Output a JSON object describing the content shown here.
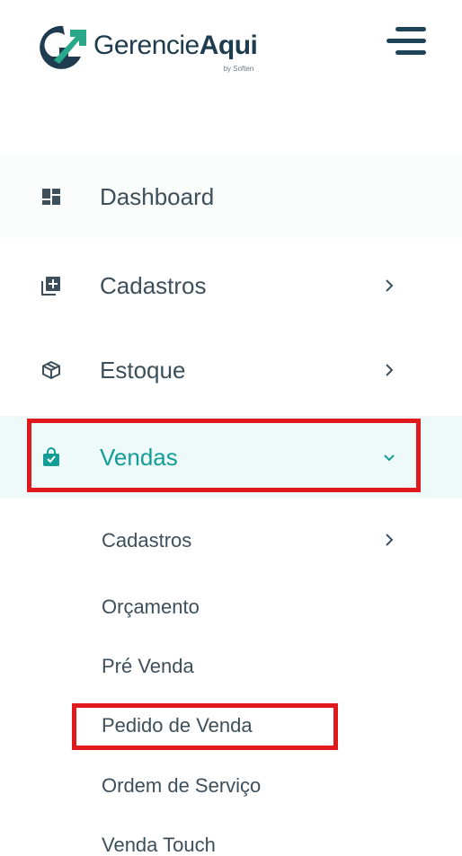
{
  "brand": {
    "name_light": "Gerencie",
    "name_bold": "Aqui",
    "tagline": "by Soften",
    "colors": {
      "dark": "#1f3b4f",
      "green": "#2aa98a"
    }
  },
  "header": {
    "menu_toggle_icon": "hamburger-icon"
  },
  "menu": {
    "items": [
      {
        "label": "Dashboard",
        "icon": "dashboard-icon",
        "has_chevron": false
      },
      {
        "label": "Cadastros",
        "icon": "add-box-icon",
        "has_chevron": true,
        "chevron": "chevron-right"
      },
      {
        "label": "Estoque",
        "icon": "package-icon",
        "has_chevron": true,
        "chevron": "chevron-right"
      },
      {
        "label": "Vendas",
        "icon": "shopping-bag-icon",
        "has_chevron": true,
        "chevron": "chevron-down",
        "active": true
      }
    ],
    "submenu": [
      {
        "label": "Cadastros",
        "has_chevron": true
      },
      {
        "label": "Orçamento"
      },
      {
        "label": "Pré Venda"
      },
      {
        "label": "Pedido de Venda"
      },
      {
        "label": "Ordem de Serviço"
      },
      {
        "label": "Venda Touch"
      }
    ]
  },
  "theme": {
    "active_color": "#129e97",
    "active_bg": "#eefafa",
    "text_color": "#3d4f5b",
    "highlight_color": "#e0191d"
  }
}
